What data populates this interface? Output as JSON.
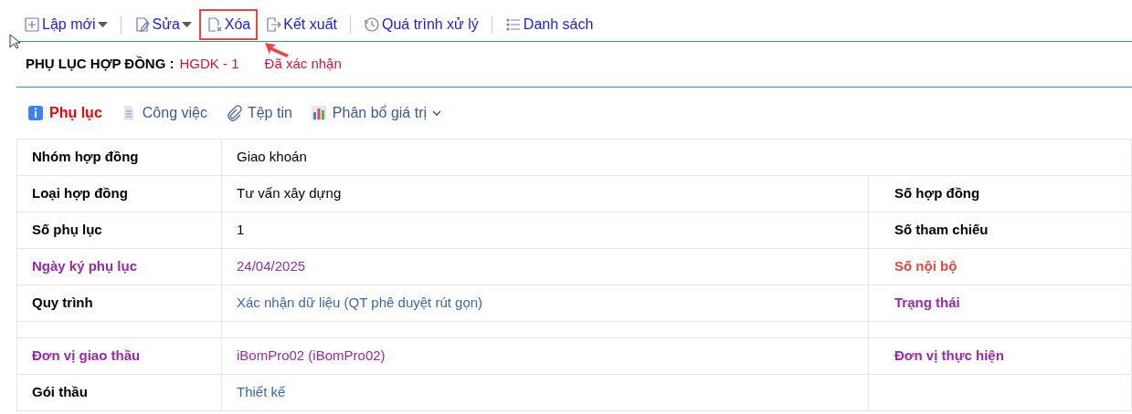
{
  "toolbar_groups": [
    [
      {
        "label": "Lập mới",
        "dropdown": true,
        "highlighted": false
      }
    ],
    [
      {
        "label": "Sửa",
        "dropdown": true,
        "highlighted": false
      },
      {
        "label": "Xóa",
        "dropdown": false,
        "highlighted": true
      },
      {
        "label": "Kết xuất",
        "dropdown": false,
        "highlighted": false
      }
    ],
    [
      {
        "label": "Quá trình xử lý",
        "dropdown": false,
        "highlighted": false
      }
    ],
    [
      {
        "label": "Danh sách",
        "dropdown": false,
        "highlighted": false
      }
    ]
  ],
  "header": {
    "title": "PHỤ LỤC HỢP ĐỒNG :",
    "code": "HGDK - 1",
    "status": "Đã xác nhận"
  },
  "tabs": [
    {
      "label": "Phụ lục",
      "selected": true,
      "dropdown": false
    },
    {
      "label": "Công việc",
      "selected": false,
      "dropdown": false
    },
    {
      "label": "Tệp tin",
      "selected": false,
      "dropdown": false
    },
    {
      "label": "Phân bổ giá trị",
      "selected": false,
      "dropdown": true
    }
  ],
  "rows": [
    {
      "kind": "wide",
      "label": "Nhóm hợp đồng",
      "required": false,
      "value": "Giao khoán",
      "link": false
    },
    {
      "kind": "pair",
      "label": "Loại hợp đồng",
      "required": false,
      "value": "Tư vấn xây dựng",
      "link": false,
      "right_label": "Số hợp đồng",
      "right_required": false,
      "right_alert": false
    },
    {
      "kind": "pair",
      "label": "Số phụ lục",
      "required": false,
      "value": "1",
      "link": false,
      "right_label": "Số tham chiếu",
      "right_required": false,
      "right_alert": false
    },
    {
      "kind": "pair",
      "label": "Ngày ký phụ lục",
      "required": true,
      "value": "24/04/2025",
      "link": false,
      "right_label": "Số nội bộ",
      "right_required": false,
      "right_alert": true
    },
    {
      "kind": "pair",
      "label": "Quy trình",
      "required": false,
      "value": "Xác nhận dữ liệu (QT phê duyệt rút gọn)",
      "link": true,
      "right_label": "Trạng thái",
      "right_required": true,
      "right_alert": false
    },
    {
      "kind": "spacer"
    },
    {
      "kind": "pair",
      "label": "Đơn vị giao thầu",
      "required": true,
      "value": "iBomPro02 (iBomPro02)",
      "link": false,
      "right_label": "Đơn vị thực hiện",
      "right_required": true,
      "right_alert": false
    },
    {
      "kind": "pair",
      "label": "Gói thầu",
      "required": false,
      "value": "Thiết kế",
      "link": true
    }
  ]
}
